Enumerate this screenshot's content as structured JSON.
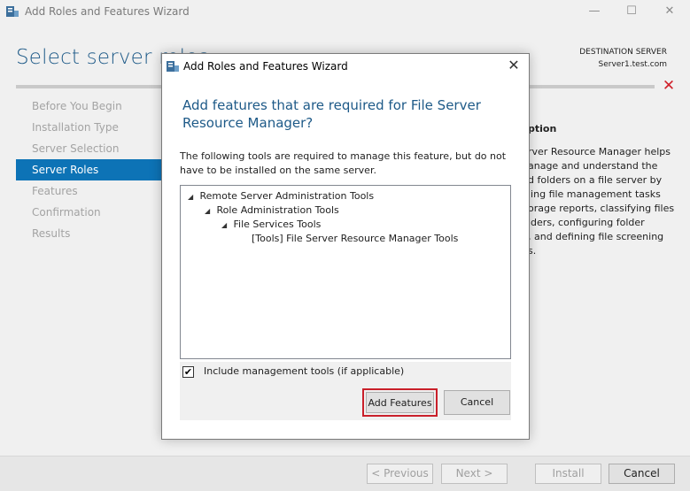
{
  "window": {
    "title": "Add Roles and Features Wizard",
    "controls": {
      "minimize": "—",
      "maximize": "☐",
      "close": "✕"
    }
  },
  "page": {
    "heading": "Select server roles",
    "destination_label": "DESTINATION SERVER",
    "destination_server": "Server1.test.com"
  },
  "nav": {
    "items": [
      {
        "label": "Before You Begin",
        "active": false
      },
      {
        "label": "Installation Type",
        "active": false
      },
      {
        "label": "Server Selection",
        "active": false
      },
      {
        "label": "Server Roles",
        "active": true
      },
      {
        "label": "Features",
        "active": false
      },
      {
        "label": "Confirmation",
        "active": false
      },
      {
        "label": "Results",
        "active": false
      }
    ]
  },
  "background_description": {
    "head": "ption",
    "lines": [
      "rver Resource Manager helps",
      "anage and understand the",
      "d folders on a file server by",
      "ling file management tasks",
      "orage reports, classifying files",
      "lders, configuring folder",
      ", and defining file screening",
      "s."
    ]
  },
  "footer": {
    "previous": "< Previous",
    "next": "Next >",
    "install": "Install",
    "cancel": "Cancel"
  },
  "dialog": {
    "title": "Add Roles and Features Wizard",
    "close": "✕",
    "heading": "Add features that are required for File Server Resource Manager?",
    "description": "The following tools are required to manage this feature, but do not have to be installed on the same server.",
    "tree": [
      {
        "label": "Remote Server Administration Tools",
        "expander": "◢",
        "level": 0
      },
      {
        "label": "Role Administration Tools",
        "expander": "◢",
        "level": 1
      },
      {
        "label": "File Services Tools",
        "expander": "◢",
        "level": 2
      },
      {
        "label": "[Tools] File Server Resource Manager Tools",
        "expander": "",
        "level": 3
      }
    ],
    "include_tools_label": "Include management tools (if applicable)",
    "include_tools_checked": true,
    "check_mark": "✔",
    "add_features": "Add Features",
    "cancel": "Cancel"
  },
  "colors": {
    "accent": "#0d73b6",
    "heading": "#1e5a88",
    "error": "#d0202a",
    "highlight_border": "#c9202a"
  },
  "icons": {
    "app": "server-manager-icon",
    "error": "error-x-icon"
  }
}
